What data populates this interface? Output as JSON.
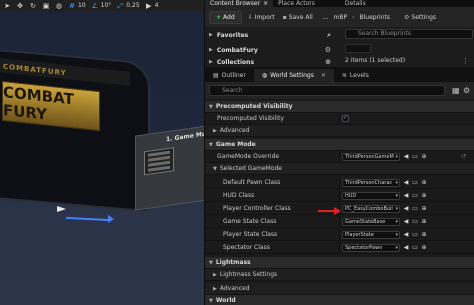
{
  "viewport": {
    "toolbar": {
      "num1": "10",
      "num2": "10°",
      "num3": "0.25",
      "num4": "4"
    },
    "sign_small": "COMBATFURY",
    "sign_big": "COMBAT FURY",
    "cabinet_label": "1. Game Mo"
  },
  "tabs": [
    {
      "label": "Content Browser",
      "close": "×"
    },
    {
      "label": "Place Actors",
      "close": ""
    },
    {
      "label": "Details",
      "close": ""
    }
  ],
  "cb_toolbar": {
    "add": "Add",
    "import": "Import",
    "save_all": "Save All",
    "crumb1": "...",
    "crumb2": "mBP",
    "crumb3": "Blueprints",
    "settings": "Settings"
  },
  "cb_body": {
    "favorites": "Favorites",
    "folder": "CombatFury",
    "collections": "Collections",
    "search_placeholder": "Search Blueprints",
    "count": "2 items (1 selected)"
  },
  "ol_tabs": [
    {
      "label": "Outliner"
    },
    {
      "label": "World Settings"
    },
    {
      "label": "Levels"
    }
  ],
  "ws_search_placeholder": "Search",
  "props": {
    "precomputed_visibility": "Precomputed Visibility",
    "precomputed_visibility_prop": "Precomputed Visibility",
    "advanced": "Advanced",
    "game_mode": "Game Mode",
    "gamemode_override": "GameMode Override",
    "gamemode_override_value": "ThirdPersonGameM",
    "selected_gamemode": "Selected GameMode",
    "default_pawn_class": "Default Pawn Class",
    "default_pawn_value": "ThirdPersonCharac",
    "hud_class": "HUD Class",
    "hud_value": "HUD",
    "player_controller_class": "Player Controller Class",
    "player_controller_value": "PC_EasyComboBuil",
    "game_state_class": "Game State Class",
    "game_state_value": "GameStateBase",
    "player_state_class": "Player State Class",
    "player_state_value": "PlayerState",
    "spectator_class": "Spectator Class",
    "spectator_value": "SpectatorPawn",
    "lightmass": "Lightmass",
    "lightmass_settings": "Lightmass Settings",
    "advanced2": "Advanced",
    "world": "World"
  }
}
